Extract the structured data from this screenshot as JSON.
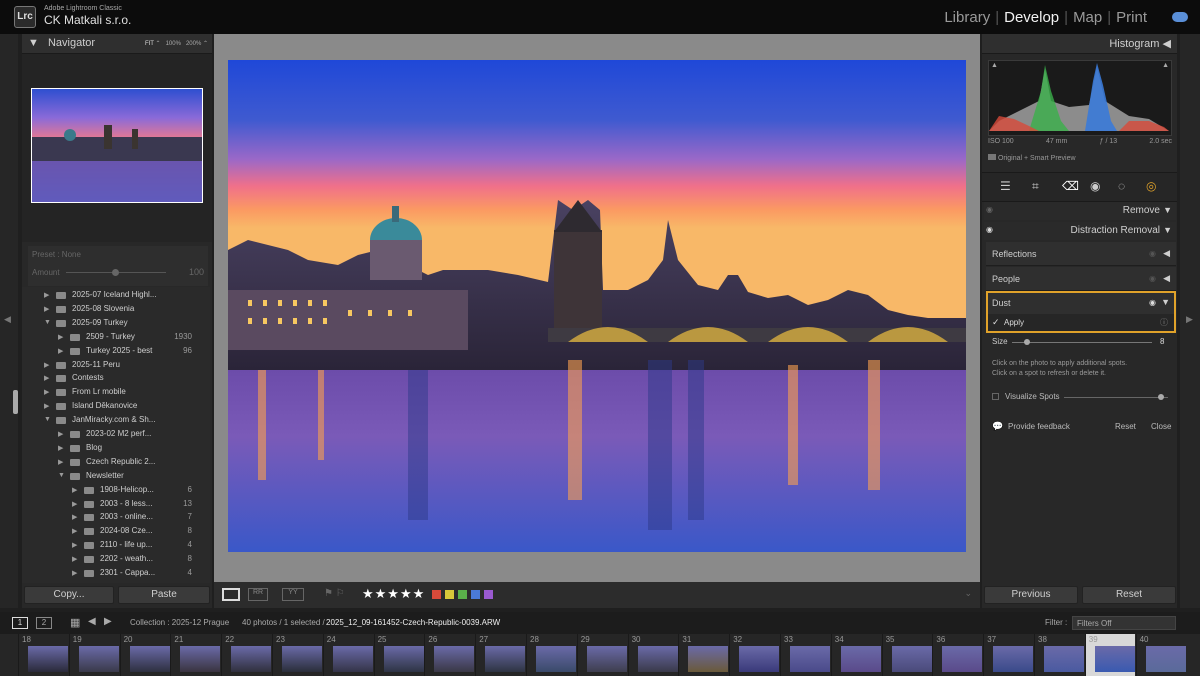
{
  "app": {
    "name": "Adobe Lightroom Classic",
    "identity": "CK Matkali s.r.o.",
    "logo": "Lrc"
  },
  "modules": [
    {
      "label": "Library",
      "active": false
    },
    {
      "label": "Develop",
      "active": true
    },
    {
      "label": "Map",
      "active": false
    },
    {
      "label": "Print",
      "active": false
    }
  ],
  "navigator": {
    "title": "Navigator",
    "zoom_options": [
      "FIT",
      "100%",
      "200%"
    ]
  },
  "preset": {
    "label": "Preset : None",
    "amount_label": "Amount",
    "amount_value": "100"
  },
  "folders": [
    {
      "label": "2025-07 Iceland Highl...",
      "count": "",
      "level": 1
    },
    {
      "label": "2025-08 Slovenia",
      "count": "",
      "level": 1
    },
    {
      "label": "2025-09 Turkey",
      "count": "",
      "level": 1
    },
    {
      "label": "2509 - Turkey",
      "count": "1930",
      "level": 2
    },
    {
      "label": "Turkey 2025 - best",
      "count": "96",
      "level": 2
    },
    {
      "label": "2025-11 Peru",
      "count": "",
      "level": 1
    },
    {
      "label": "Contests",
      "count": "",
      "level": 1
    },
    {
      "label": "From Lr mobile",
      "count": "",
      "level": 1
    },
    {
      "label": "Island Děkanovice",
      "count": "",
      "level": 1
    },
    {
      "label": "JanMiracky.com & Sh...",
      "count": "",
      "level": 1
    },
    {
      "label": "2023-02 M2 perf...",
      "count": "",
      "level": 2
    },
    {
      "label": "Blog",
      "count": "",
      "level": 2
    },
    {
      "label": "Czech Republic 2...",
      "count": "",
      "level": 2
    },
    {
      "label": "Newsletter",
      "count": "",
      "level": 2
    },
    {
      "label": "1908-Helicop...",
      "count": "6",
      "level": 3
    },
    {
      "label": "2003 - 8 less...",
      "count": "13",
      "level": 3
    },
    {
      "label": "2003 - online...",
      "count": "7",
      "level": 3
    },
    {
      "label": "2024-08 Cze...",
      "count": "8",
      "level": 3
    },
    {
      "label": "2110 - life up...",
      "count": "4",
      "level": 3
    },
    {
      "label": "2202 - weath...",
      "count": "8",
      "level": 3
    },
    {
      "label": "2301 - Cappa...",
      "count": "4",
      "level": 3
    }
  ],
  "left_buttons": {
    "copy": "Copy...",
    "paste": "Paste"
  },
  "histogram": {
    "title": "Histogram",
    "iso": "ISO 100",
    "focal": "47 mm",
    "aperture": "ƒ / 13",
    "shutter": "2.0 sec",
    "preview": "Original + Smart Preview"
  },
  "remove": {
    "title": "Remove",
    "distraction": "Distraction Removal",
    "reflections": "Reflections",
    "people": "People",
    "dust": "Dust",
    "apply": "Apply",
    "size_label": "Size",
    "size_value": "8",
    "hint1": "Click on the photo to apply additional spots.",
    "hint2": "Click on a spot to refresh or delete it.",
    "visualize": "Visualize Spots",
    "feedback": "Provide feedback",
    "reset_small": "Reset",
    "close": "Close"
  },
  "right_buttons": {
    "previous": "Previous",
    "reset": "Reset"
  },
  "filmstrip": {
    "views": [
      "1",
      "2"
    ],
    "collection": "Collection : 2025-12 Prague",
    "count": "40 photos / 1 selected /",
    "filename": "2025_12_09-161452-Czech-Republic-0039.ARW",
    "filter_label": "Filter :",
    "filter_value": "Filters Off",
    "numbers": [
      "18",
      "19",
      "20",
      "21",
      "22",
      "23",
      "24",
      "25",
      "26",
      "27",
      "28",
      "29",
      "30",
      "31",
      "32",
      "33",
      "34",
      "35",
      "36",
      "37",
      "38",
      "39",
      "40"
    ]
  },
  "rating": "★★★★★",
  "colors": {
    "accent": "#e0a22a",
    "labels": [
      "#d84a3a",
      "#d8c83a",
      "#5ab04a",
      "#4a7ad8",
      "#9a5ad0"
    ]
  }
}
